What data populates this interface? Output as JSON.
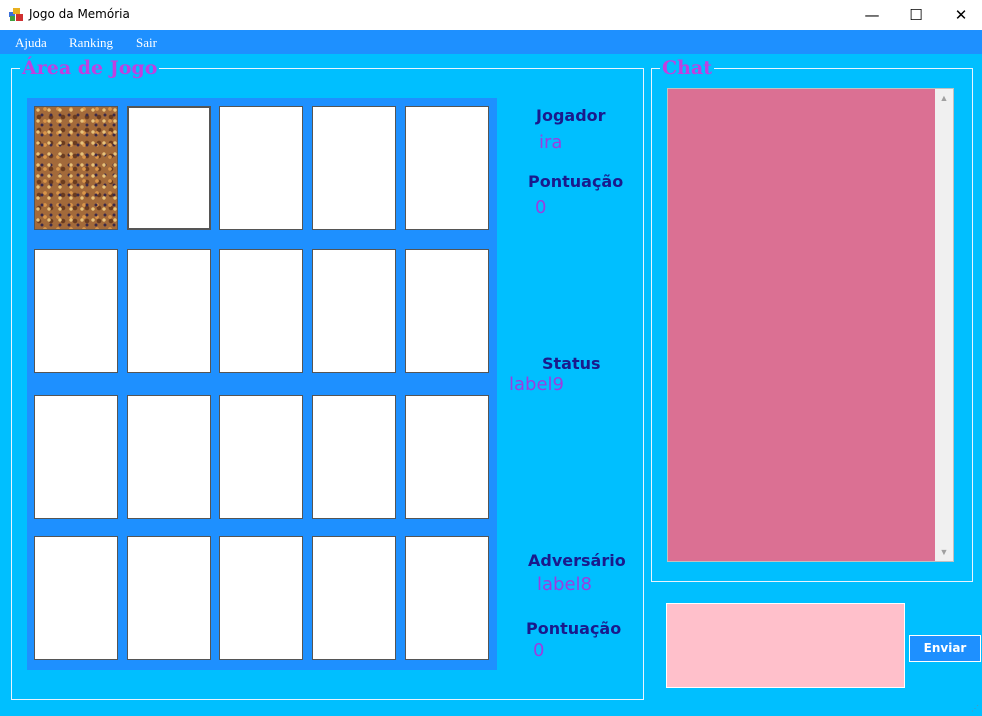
{
  "window": {
    "title": "Jogo da Memória",
    "minimize_glyph": "—",
    "maximize_glyph": "☐",
    "close_glyph": "✕",
    "icon": "app-icon"
  },
  "menu": {
    "items": [
      {
        "label": "Ajuda"
      },
      {
        "label": "Ranking"
      },
      {
        "label": "Sair"
      }
    ]
  },
  "game": {
    "group_title": "Área de Jogo",
    "cards": {
      "rows": 4,
      "cols": 5,
      "face_down_indices": [
        0
      ],
      "selected_indices": [
        1
      ]
    },
    "player": {
      "label": "Jogador",
      "name": "ira",
      "score_label": "Pontuação",
      "score": "0"
    },
    "status": {
      "label": "Status",
      "value": "label9"
    },
    "opponent": {
      "label": "Adversário",
      "name": "label8",
      "score_label": "Pontuação",
      "score": "0"
    }
  },
  "chat": {
    "group_title": "Chat",
    "log_text": "",
    "message_value": "",
    "send_label": "Enviar"
  },
  "colors": {
    "background": "#00BFFF",
    "menubar": "#1E90FF",
    "board": "#1E90FF",
    "group_title": "#C040E0",
    "label": "#1a1a8c",
    "value": "#9b3de0",
    "chat_log": "#DB7093",
    "message_input": "#FFC0CB"
  }
}
